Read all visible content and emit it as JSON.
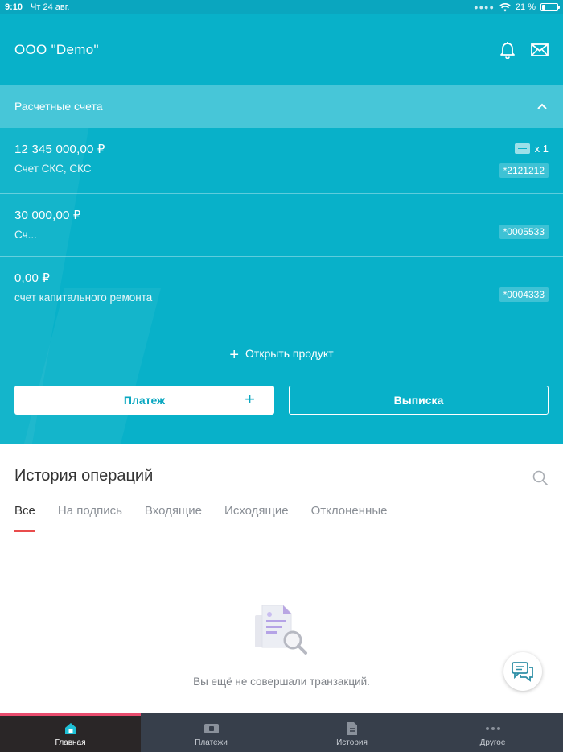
{
  "status_bar": {
    "time": "9:10",
    "date": "Чт 24 авг.",
    "battery": "21 %",
    "battery_level": 0.21
  },
  "header": {
    "company": "ООО \"Demo\""
  },
  "accounts": {
    "section_title": "Расчетные счета",
    "items": [
      {
        "amount": "12 345 000,00 ₽",
        "name": "Счет СКС, СКС",
        "number": "*2121212",
        "cards": "x 1"
      },
      {
        "amount": "30 000,00 ₽",
        "name": "Сч...",
        "number": "*0005533"
      },
      {
        "amount": "0,00 ₽",
        "name": "счет капитального ремонта",
        "number": "*0004333"
      }
    ]
  },
  "open_product": "Открыть продукт",
  "buttons": {
    "payment": "Платеж",
    "statement": "Выписка"
  },
  "history": {
    "title": "История операций",
    "tabs": [
      "Все",
      "На подпись",
      "Входящие",
      "Исходящие",
      "Отклоненные"
    ],
    "active_tab": "Все",
    "empty_text": "Вы ещё не совершали транзакций."
  },
  "nav": {
    "items": [
      {
        "label": "Главная",
        "icon": "home-icon"
      },
      {
        "label": "Платежи",
        "icon": "wallet-icon"
      },
      {
        "label": "История",
        "icon": "document-icon"
      },
      {
        "label": "Другое",
        "icon": "more-icon"
      }
    ],
    "active": "Главная"
  },
  "colors": {
    "primary": "#08b1c9",
    "accent": "#e94c4c",
    "nav_bg": "#373f4b"
  }
}
